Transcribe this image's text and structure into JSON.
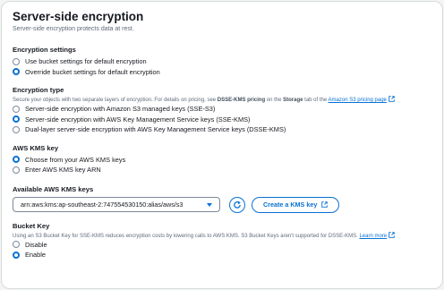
{
  "header": {
    "title": "Server-side encryption",
    "subtitle": "Server-side encryption protects data at rest."
  },
  "encryption_settings": {
    "label": "Encryption settings",
    "options": [
      {
        "label": "Use bucket settings for default encryption",
        "selected": false
      },
      {
        "label": "Override bucket settings for default encryption",
        "selected": true
      }
    ]
  },
  "encryption_type": {
    "label": "Encryption type",
    "desc_prefix": "Secure your objects with two separate layers of encryption. For details on pricing, see ",
    "desc_bold1": "DSSE-KMS pricing",
    "desc_mid": " on the ",
    "desc_bold2": "Storage",
    "desc_suffix": " tab of the ",
    "desc_link": "Amazon S3 pricing page",
    "options": [
      {
        "label": "Server-side encryption with Amazon S3 managed keys (SSE-S3)",
        "selected": false
      },
      {
        "label": "Server-side encryption with AWS Key Management Service keys (SSE-KMS)",
        "selected": true
      },
      {
        "label": "Dual-layer server-side encryption with AWS Key Management Service keys (DSSE-KMS)",
        "selected": false
      }
    ]
  },
  "kms_key": {
    "label": "AWS KMS key",
    "options": [
      {
        "label": "Choose from your AWS KMS keys",
        "selected": true
      },
      {
        "label": "Enter AWS KMS key ARN",
        "selected": false
      }
    ]
  },
  "available_keys": {
    "label": "Available AWS KMS keys",
    "selected_value": "arn:aws:kms:ap-southeast-2:747554530150:alias/aws/s3",
    "create_button": "Create a KMS key"
  },
  "bucket_key": {
    "label": "Bucket Key",
    "desc": "Using an S3 Bucket Key for SSE-KMS reduces encryption costs by lowering calls to AWS KMS. S3 Bucket Keys aren't supported for DSSE-KMS.",
    "learn_more": "Learn more",
    "options": [
      {
        "label": "Disable",
        "selected": false
      },
      {
        "label": "Enable",
        "selected": true
      }
    ]
  },
  "colors": {
    "accent": "#0972d3",
    "text": "#16191f",
    "muted": "#5f6b7a"
  }
}
